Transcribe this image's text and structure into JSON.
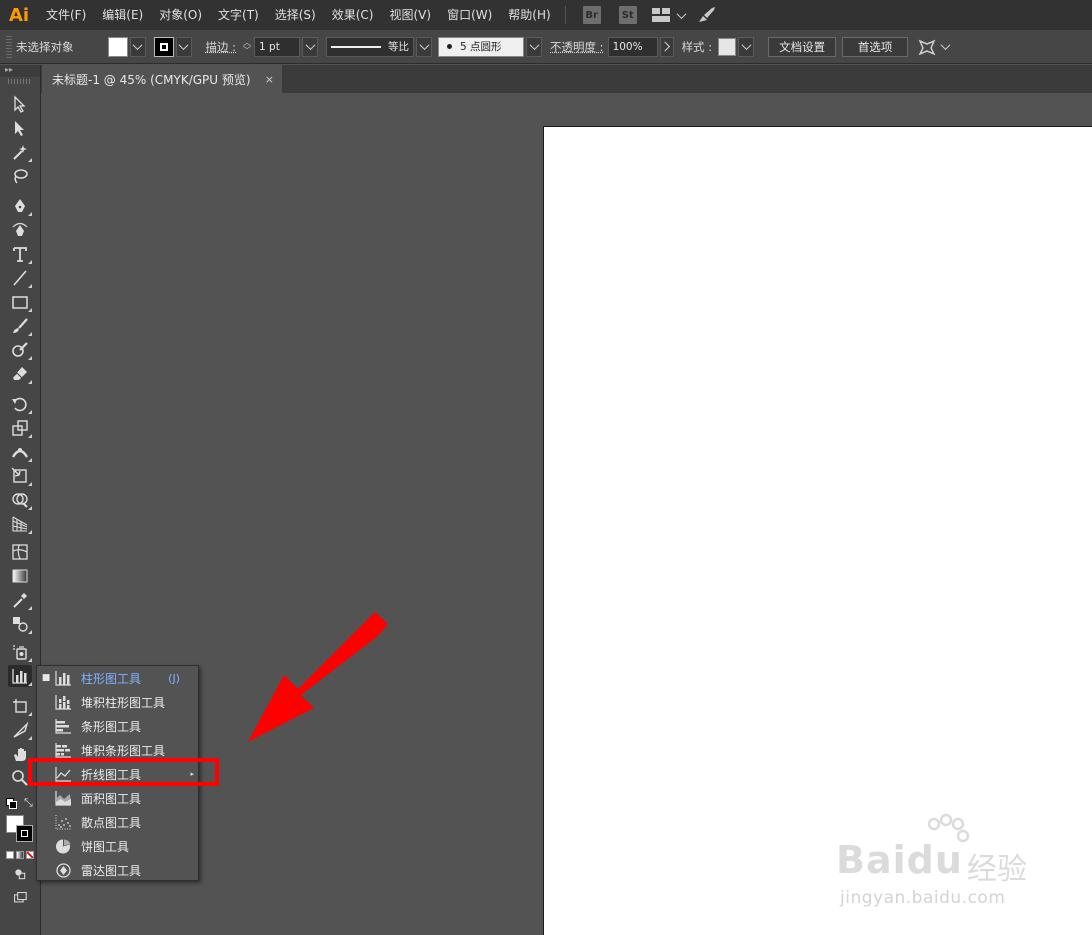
{
  "app": {
    "logo": "Ai"
  },
  "menu": [
    "文件(F)",
    "编辑(E)",
    "对象(O)",
    "文字(T)",
    "选择(S)",
    "效果(C)",
    "视图(V)",
    "窗口(W)",
    "帮助(H)"
  ],
  "menu_apps": [
    "Br",
    "St"
  ],
  "control_bar": {
    "selection": "未选择对象",
    "stroke_label": "描边 :",
    "stroke_weight": "1 pt",
    "stroke_profile": "等比",
    "brush": "5 点圆形",
    "opacity_label": "不透明度 :",
    "opacity": "100%",
    "style_label": "样式 :",
    "doc_setup": "文档设置",
    "preferences": "首选项"
  },
  "tab": {
    "title": "未标题-1 @ 45% (CMYK/GPU 预览)",
    "close": "×"
  },
  "toolbar_head": "▸▸",
  "flyout": {
    "items": [
      {
        "label": "柱形图工具",
        "shortcut": "(J)",
        "checked": true,
        "icon": "column-graph-icon"
      },
      {
        "label": "堆积柱形图工具",
        "icon": "stacked-column-graph-icon"
      },
      {
        "label": "条形图工具",
        "icon": "bar-graph-icon"
      },
      {
        "label": "堆积条形图工具",
        "icon": "stacked-bar-graph-icon"
      },
      {
        "label": "折线图工具",
        "icon": "line-graph-icon",
        "submenu": true
      },
      {
        "label": "面积图工具",
        "icon": "area-graph-icon"
      },
      {
        "label": "散点图工具",
        "icon": "scatter-graph-icon"
      },
      {
        "label": "饼图工具",
        "icon": "pie-graph-icon"
      },
      {
        "label": "雷达图工具",
        "icon": "radar-graph-icon"
      }
    ],
    "check_mark": "■",
    "submenu_mark": "▸"
  },
  "watermark": {
    "logo": "Baidu",
    "cn": "经验",
    "url": "jingyan.baidu.com"
  },
  "colors": {
    "annotation": "#ff0000",
    "accent": "#7fb2ff",
    "logo": "#ff9a00"
  }
}
